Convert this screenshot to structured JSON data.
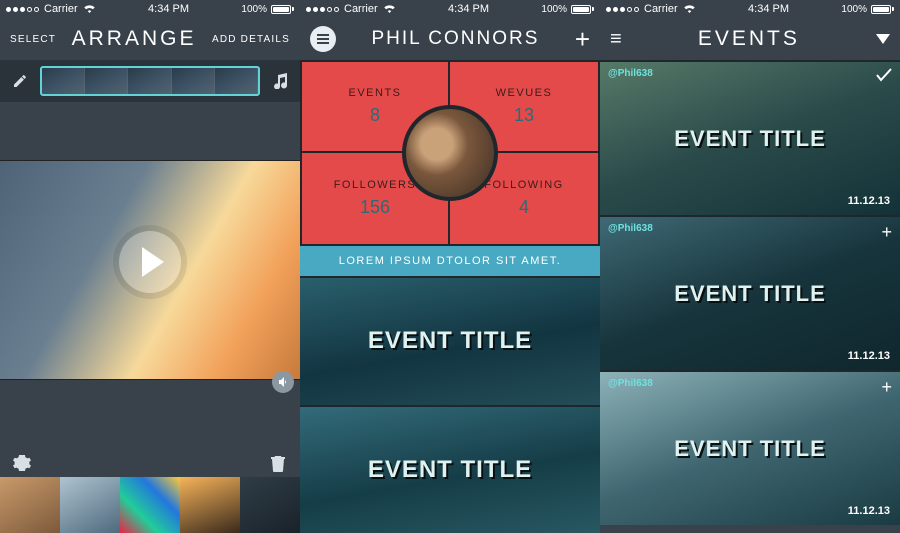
{
  "status": {
    "carrier": "Carrier",
    "time": "4:34 PM",
    "battery_pct": "100%"
  },
  "screen1": {
    "header": {
      "left": "SELECT",
      "title": "ARRANGE",
      "right": "ADD DETAILS"
    },
    "timeline": {
      "thumb_count": 5
    },
    "thumbs": {
      "count": 5
    }
  },
  "screen2": {
    "header": {
      "title": "PHIL CONNORS"
    },
    "stats": {
      "events": {
        "label": "EVENTS",
        "value": "8"
      },
      "wevues": {
        "label": "WEVUES",
        "value": "13"
      },
      "followers": {
        "label": "FOLLOWERS",
        "value": "156"
      },
      "following": {
        "label": "FOLLOWING",
        "value": "4"
      }
    },
    "bio": "LOREM IPSUM DTOLOR SIT AMET.",
    "events": [
      {
        "title": "EVENT TITLE"
      },
      {
        "title": "EVENT TITLE"
      }
    ]
  },
  "screen3": {
    "header": {
      "title": "EVENTS"
    },
    "events": [
      {
        "handle": "@Phil638",
        "title": "EVENT TITLE",
        "date": "11.12.13",
        "corner": "check"
      },
      {
        "handle": "@Phil638",
        "title": "EVENT TITLE",
        "date": "11.12.13",
        "corner": "plus"
      },
      {
        "handle": "@Phil638",
        "title": "EVENT TITLE",
        "date": "11.12.13",
        "corner": "plus"
      }
    ]
  }
}
